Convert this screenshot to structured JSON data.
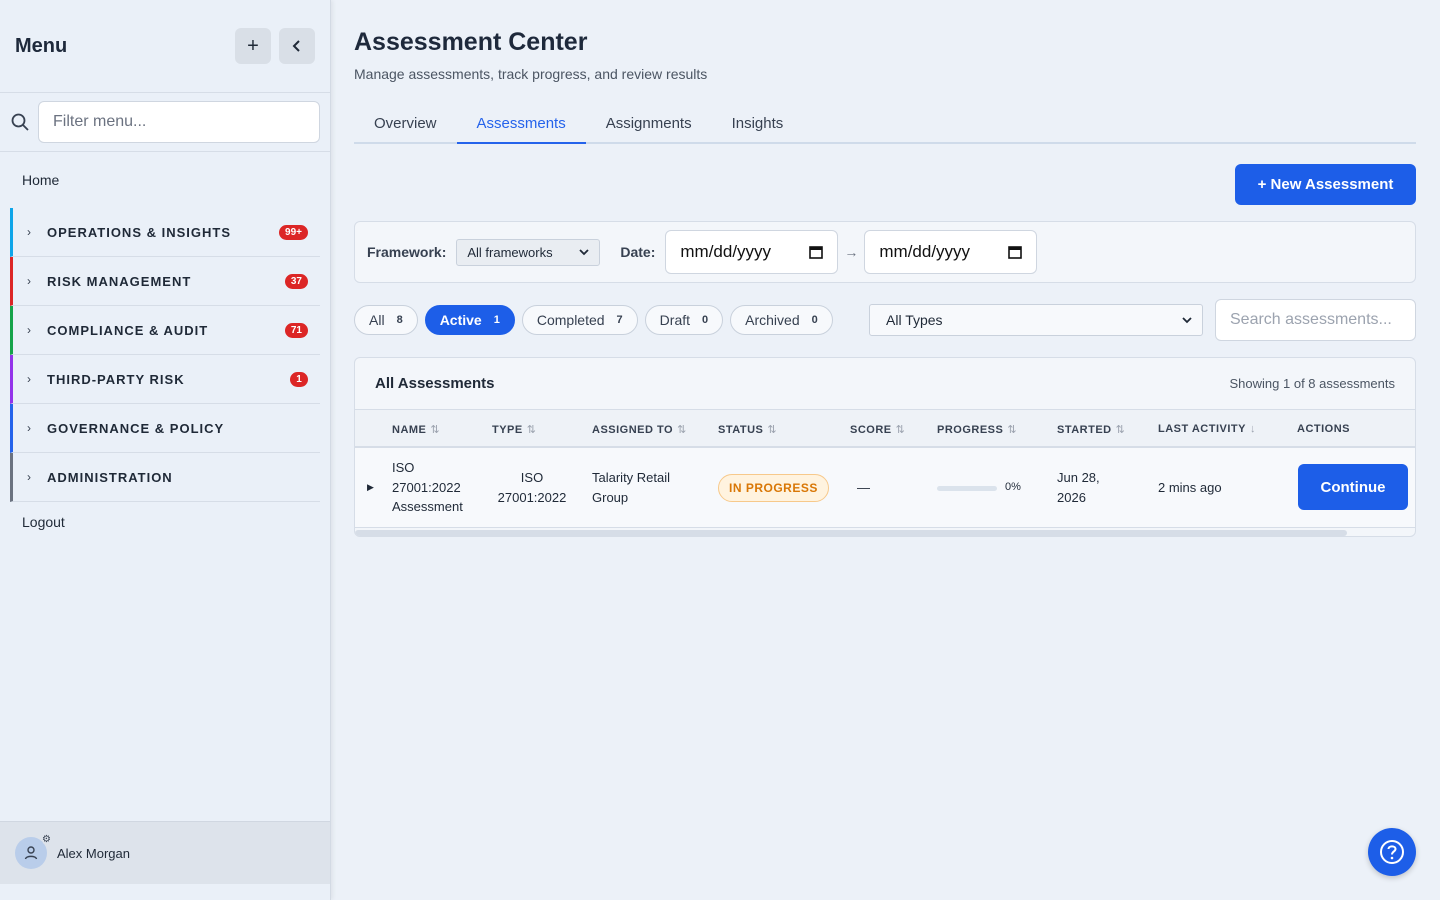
{
  "sidebar": {
    "title": "Menu",
    "filter_placeholder": "Filter menu...",
    "home": "Home",
    "sections": [
      {
        "label": "OPERATIONS & INSIGHTS",
        "badge": "99+",
        "color": "#0ea5e9"
      },
      {
        "label": "RISK MANAGEMENT",
        "badge": "37",
        "color": "#dc2626"
      },
      {
        "label": "COMPLIANCE & AUDIT",
        "badge": "71",
        "color": "#16a34a"
      },
      {
        "label": "THIRD-PARTY RISK",
        "badge": "1",
        "color": "#9333ea"
      },
      {
        "label": "GOVERNANCE & POLICY",
        "badge": "",
        "color": "#2563eb"
      },
      {
        "label": "ADMINISTRATION",
        "badge": "",
        "color": "#6b7280"
      }
    ],
    "logout": "Logout",
    "user": "Alex Morgan"
  },
  "header": {
    "title": "Assessment Center",
    "subtitle": "Manage assessments, track progress, and review results"
  },
  "tabs": [
    "Overview",
    "Assessments",
    "Assignments",
    "Insights"
  ],
  "new_button": "+ New Assessment",
  "filters": {
    "framework_label": "Framework:",
    "framework_value": "All frameworks",
    "date_label": "Date:",
    "date_from": "mm/dd/yyyy",
    "date_to": "mm/dd/yyyy",
    "arrow": "→"
  },
  "chips": [
    {
      "label": "All",
      "count": "8"
    },
    {
      "label": "Active",
      "count": "1"
    },
    {
      "label": "Completed",
      "count": "7"
    },
    {
      "label": "Draft",
      "count": "0"
    },
    {
      "label": "Archived",
      "count": "0"
    }
  ],
  "type_select": "All Types",
  "search_placeholder": "Search assessments...",
  "table": {
    "title": "All Assessments",
    "showing": "Showing 1 of 8 assessments",
    "columns": [
      "NAME",
      "TYPE",
      "ASSIGNED TO",
      "STATUS",
      "SCORE",
      "PROGRESS",
      "STARTED",
      "LAST ACTIVITY",
      "ACTIONS"
    ],
    "row": {
      "name": "ISO 27001:2022 Assessment",
      "type": "ISO 27001:2022",
      "assigned": "Talarity Retail Group",
      "status": "IN PROGRESS",
      "score": "—",
      "progress_text": "0%",
      "progress": 0,
      "started": "Jun 28, 2026",
      "last_activity": "2 mins ago",
      "action": "Continue"
    }
  },
  "colors": {
    "accent": "#1d5ee8",
    "status_warning": "#d97706"
  }
}
